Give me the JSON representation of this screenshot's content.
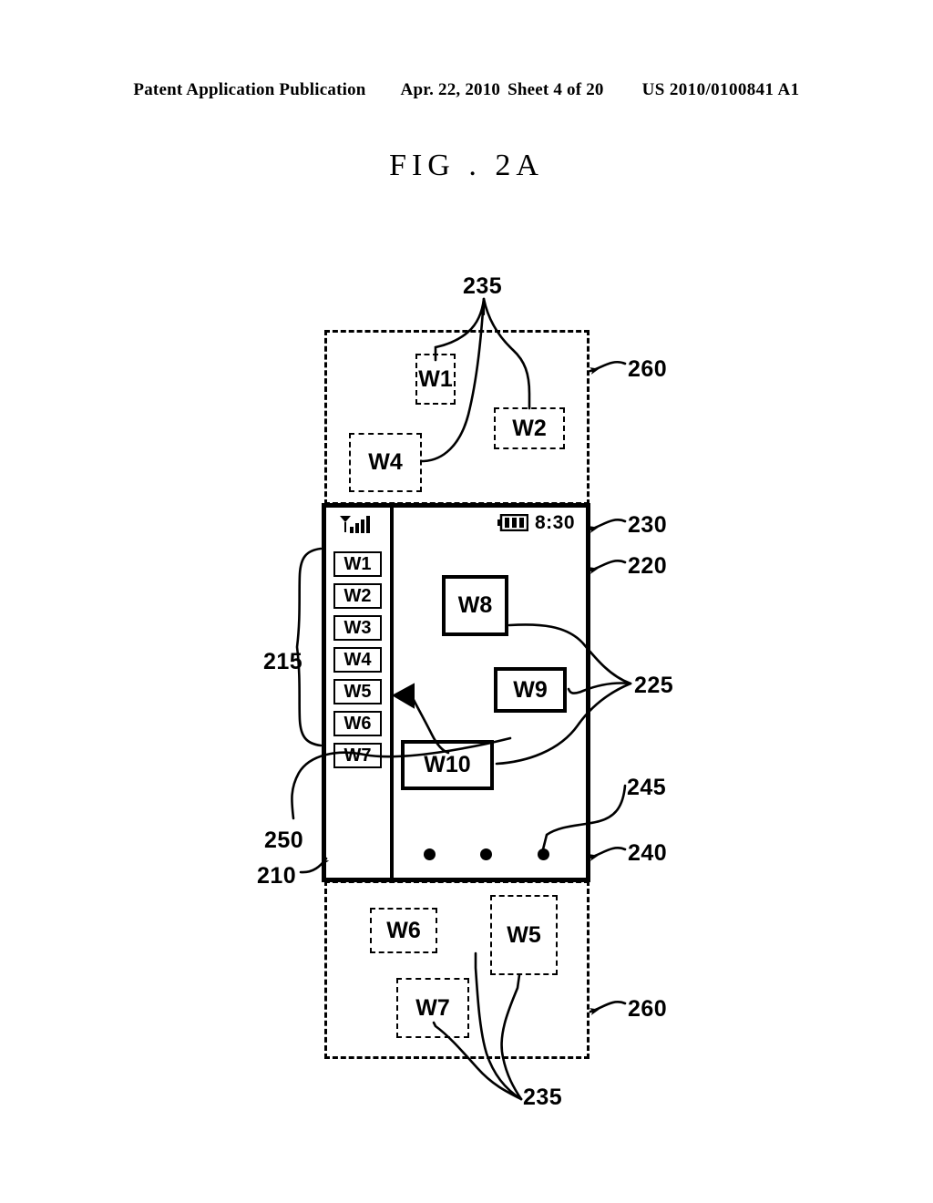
{
  "header": {
    "publication": "Patent Application Publication",
    "date": "Apr. 22, 2010",
    "sheet": "Sheet 4 of 20",
    "patent_number": "US 2010/0100841 A1"
  },
  "figure": {
    "title": "FIG . 2A"
  },
  "status_bar": {
    "signal_icon": "signal-bars-icon",
    "battery_icon": "battery-icon",
    "time": "8:30"
  },
  "sidebar": {
    "ref": "215",
    "items": [
      {
        "label": "W1"
      },
      {
        "label": "W2"
      },
      {
        "label": "W3"
      },
      {
        "label": "W4"
      },
      {
        "label": "W5"
      },
      {
        "label": "W6"
      },
      {
        "label": "W7"
      }
    ]
  },
  "screen_widgets": [
    {
      "label": "W8"
    },
    {
      "label": "W9"
    },
    {
      "label": "W10"
    }
  ],
  "top_region": {
    "ref": "260",
    "widgets": [
      {
        "label": "W1"
      },
      {
        "label": "W2"
      },
      {
        "label": "W4"
      }
    ],
    "leader_ref": "235"
  },
  "bottom_region": {
    "ref": "260",
    "widgets": [
      {
        "label": "W6"
      },
      {
        "label": "W5"
      },
      {
        "label": "W7"
      }
    ],
    "leader_ref": "235"
  },
  "refs": {
    "r235_top": "235",
    "r235_bottom": "235",
    "r260_top": "260",
    "r260_bottom": "260",
    "r230": "230",
    "r220": "220",
    "r225": "225",
    "r245": "245",
    "r240": "240",
    "r215": "215",
    "r250": "250",
    "r210": "210"
  },
  "colors": {
    "ink": "#000000",
    "paper": "#ffffff"
  }
}
